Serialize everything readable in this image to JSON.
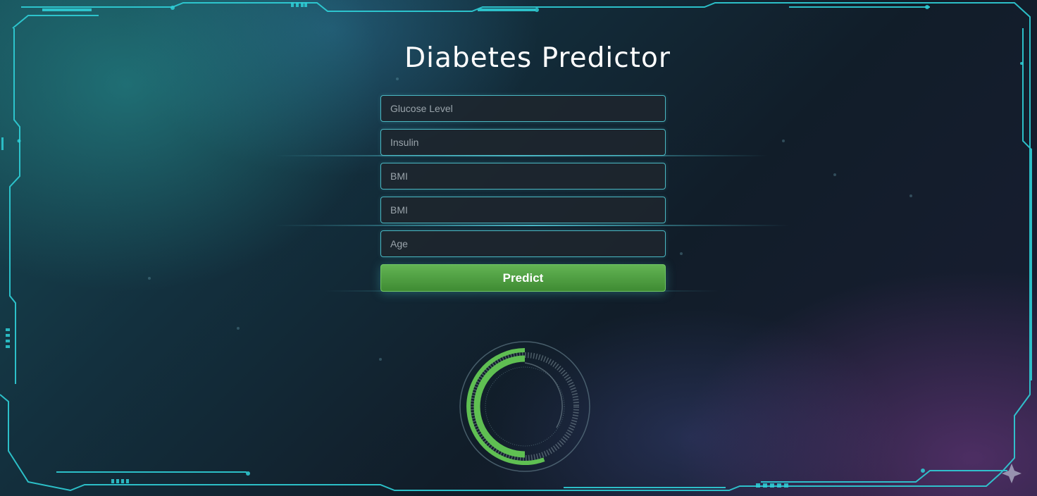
{
  "app": {
    "title": "Diabetes Predictor"
  },
  "form": {
    "fields": [
      {
        "placeholder": "Glucose Level",
        "value": ""
      },
      {
        "placeholder": "Insulin",
        "value": ""
      },
      {
        "placeholder": "BMI",
        "value": ""
      },
      {
        "placeholder": "BMI",
        "value": ""
      },
      {
        "placeholder": "Age",
        "value": ""
      }
    ],
    "submit_label": "Predict"
  },
  "gauge": {
    "progress": 0.5,
    "color": "#5fbf52"
  },
  "theme": {
    "accent": "#4ab7c2",
    "button_color": "#4f9f41"
  }
}
